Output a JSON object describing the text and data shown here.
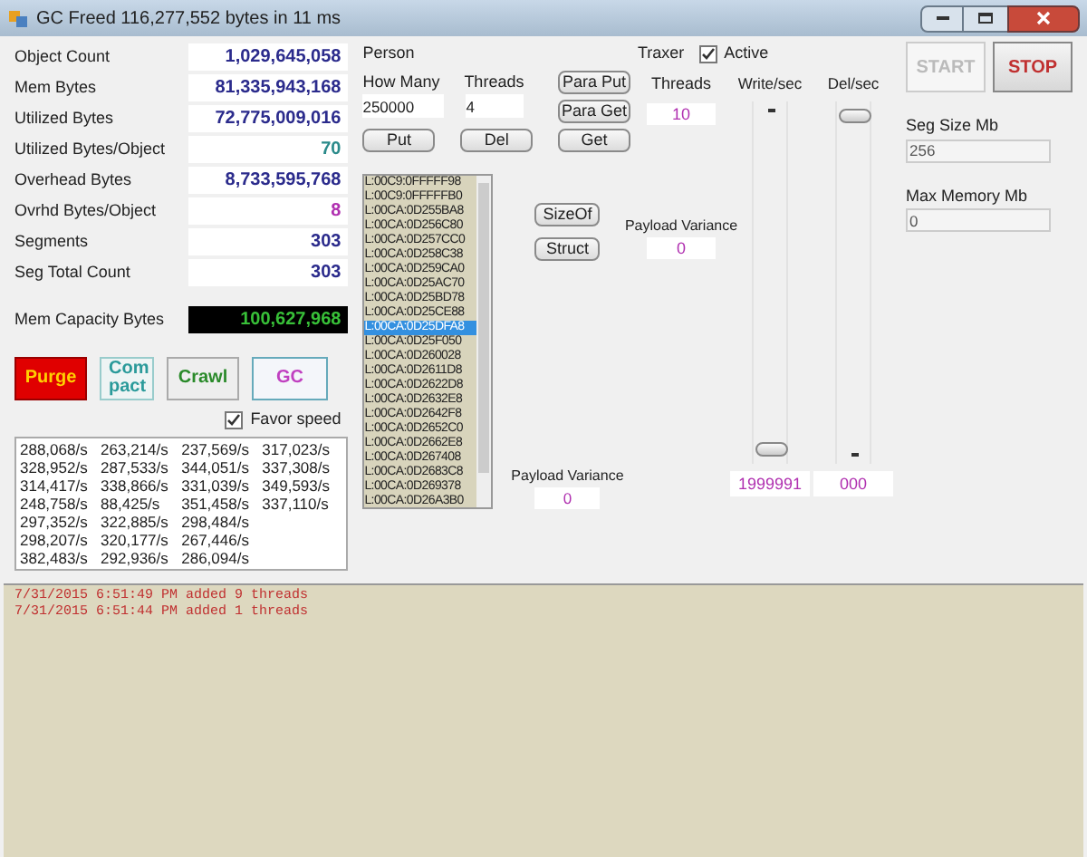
{
  "window": {
    "title": "GC Freed 116,277,552 bytes in 11 ms"
  },
  "stats": [
    {
      "label": "Object Count",
      "value": "1,029,645,058",
      "color": "#2b2b8c",
      "kind": "box"
    },
    {
      "label": "Mem Bytes",
      "value": "81,335,943,168",
      "color": "#2b2b8c",
      "kind": "box"
    },
    {
      "label": "Utilized Bytes",
      "value": "72,775,009,016",
      "color": "#2b2b8c",
      "kind": "box"
    },
    {
      "label": "Utilized Bytes/Object",
      "value": "70",
      "color": "#2a8a8a",
      "kind": "box"
    },
    {
      "label": "Overhead Bytes",
      "value": "8,733,595,768",
      "color": "#2b2b8c",
      "kind": "box"
    },
    {
      "label": "Ovrhd Bytes/Object",
      "value": "8",
      "color": "#b030b0",
      "kind": "box"
    },
    {
      "label": "Segments",
      "value": "303",
      "color": "#2b2b8c",
      "kind": "box"
    },
    {
      "label": "Seg Total Count",
      "value": "303",
      "color": "#2b2b8c",
      "kind": "box"
    },
    {
      "label": "Mem Capacity Bytes",
      "value": "100,627,968",
      "color": "#38c038",
      "kind": "display"
    }
  ],
  "actions": [
    {
      "label": "Purge",
      "kind": "danger"
    },
    {
      "label": "Com pact",
      "kind": "teal"
    },
    {
      "label": "Crawl",
      "kind": "green"
    },
    {
      "label": "GC",
      "kind": "magenta"
    }
  ],
  "favor_speed": {
    "label": "Favor speed",
    "checked": true
  },
  "rates": [
    [
      "288,068/s",
      "263,214/s",
      "237,569/s",
      "317,023/s"
    ],
    [
      "328,952/s",
      "287,533/s",
      "344,051/s",
      "337,308/s"
    ],
    [
      "314,417/s",
      "338,866/s",
      "331,039/s",
      "349,593/s"
    ],
    [
      "248,758/s",
      "88,425/s",
      "351,458/s",
      "337,110/s"
    ],
    [
      "297,352/s",
      "322,885/s",
      "298,484/s"
    ],
    [
      "298,207/s",
      "320,177/s",
      "267,446/s"
    ],
    [
      "382,483/s",
      "292,936/s",
      "286,094/s"
    ]
  ],
  "person": {
    "title": "Person",
    "how_many_label": "How Many",
    "how_many": "250000",
    "threads_label": "Threads",
    "threads": "4",
    "buttons": [
      "Para Put",
      "Para Get"
    ],
    "row_buttons": [
      "Put",
      "Del",
      "Get"
    ],
    "side_buttons": [
      "SizeOf",
      "Struct"
    ],
    "payload_variance_label": "Payload Variance",
    "payload_variance": "0",
    "items": [
      {
        "text": "L:00C9:0FFFFF98",
        "selected": false
      },
      {
        "text": "L:00C9:0FFFFFB0",
        "selected": false
      },
      {
        "text": "L:00CA:0D255BA8",
        "selected": false
      },
      {
        "text": "L:00CA:0D256C80",
        "selected": false
      },
      {
        "text": "L:00CA:0D257CC0",
        "selected": false
      },
      {
        "text": "L:00CA:0D258C38",
        "selected": false
      },
      {
        "text": "L:00CA:0D259CA0",
        "selected": false
      },
      {
        "text": "L:00CA:0D25AC70",
        "selected": false
      },
      {
        "text": "L:00CA:0D25BD78",
        "selected": false
      },
      {
        "text": "L:00CA:0D25CE88",
        "selected": false
      },
      {
        "text": "L:00CA:0D25DFA8",
        "selected": true
      },
      {
        "text": "L:00CA:0D25F050",
        "selected": false
      },
      {
        "text": "L:00CA:0D260028",
        "selected": false
      },
      {
        "text": "L:00CA:0D2611D8",
        "selected": false
      },
      {
        "text": "L:00CA:0D2622D8",
        "selected": false
      },
      {
        "text": "L:00CA:0D2632E8",
        "selected": false
      },
      {
        "text": "L:00CA:0D2642F8",
        "selected": false
      },
      {
        "text": "L:00CA:0D2652C0",
        "selected": false
      },
      {
        "text": "L:00CA:0D2662E8",
        "selected": false
      },
      {
        "text": "L:00CA:0D267408",
        "selected": false
      },
      {
        "text": "L:00CA:0D2683C8",
        "selected": false
      },
      {
        "text": "L:00CA:0D269378",
        "selected": false
      },
      {
        "text": "L:00CA:0D26A3B0",
        "selected": false
      }
    ]
  },
  "traxer": {
    "title": "Traxer",
    "active": {
      "label": "Active",
      "checked": true
    },
    "threads_label": "Threads",
    "threads": "10",
    "payload_variance_label": "Payload Variance",
    "payload_variance": "0",
    "sliders": [
      {
        "label": "Write/sec",
        "level": 0.02,
        "reading": "1999991"
      },
      {
        "label": "Del/sec",
        "level": 0.98,
        "reading": "000"
      }
    ]
  },
  "controls": {
    "start": {
      "label": "START",
      "disabled": true
    },
    "stop": {
      "label": "STOP",
      "disabled": false
    },
    "fields": [
      {
        "label": "Seg Size Mb",
        "value": "256"
      },
      {
        "label": "Max Memory Mb",
        "value": "0"
      }
    ]
  },
  "log": [
    "7/31/2015 6:51:49 PM added 9 threads",
    "7/31/2015 6:51:44 PM added 1 threads"
  ]
}
